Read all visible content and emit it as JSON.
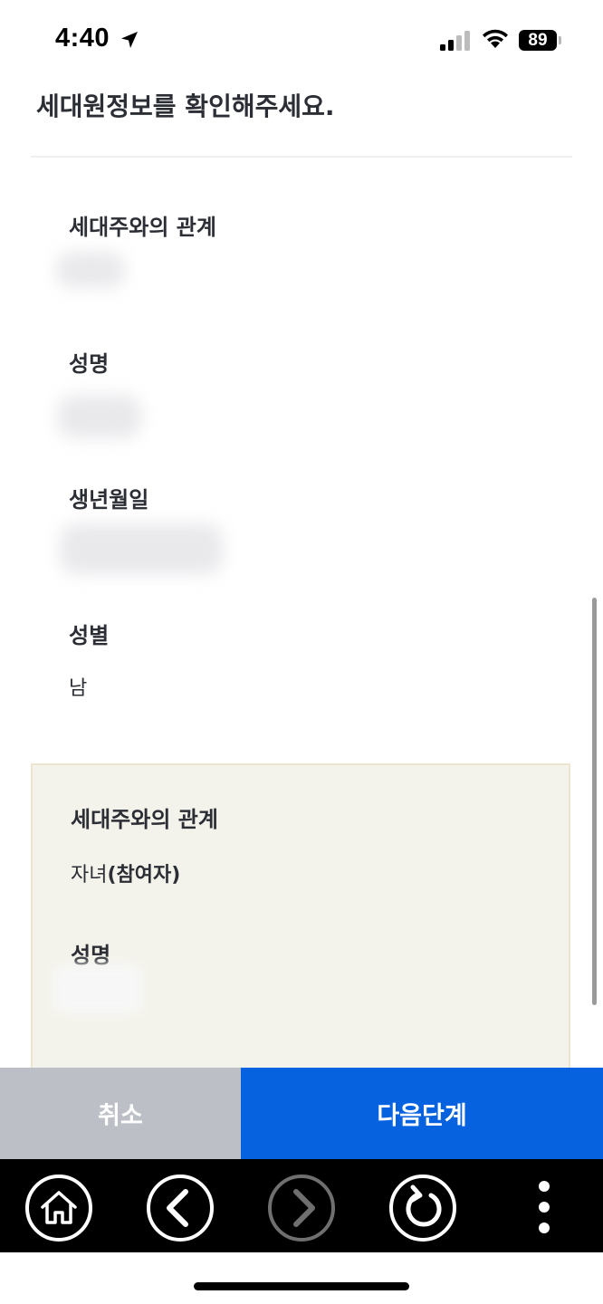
{
  "status_bar": {
    "time": "4:40",
    "battery": "89",
    "icons": [
      "location-arrow-icon",
      "cellular-signal-icon",
      "wifi-icon",
      "battery-icon"
    ]
  },
  "page": {
    "title": "세대원정보를 확인해주세요."
  },
  "fields": [
    {
      "label": "세대주와의 관계",
      "value": ""
    },
    {
      "label": "성명",
      "value": ""
    },
    {
      "label": "생년월일",
      "value": ""
    },
    {
      "label": "성별",
      "value": "남"
    }
  ],
  "card": {
    "relation_label": "세대주와의 관계",
    "relation_value_prefix": "자녀",
    "relation_value_suffix": "(참여자)",
    "name_label": "성명"
  },
  "actions": {
    "cancel": "취소",
    "next": "다음단계"
  },
  "toolbar": {
    "icons": [
      "home-icon",
      "back-icon",
      "forward-icon",
      "refresh-icon",
      "more-icon"
    ]
  },
  "colors": {
    "primary": "#0762e0",
    "cancel": "#bcc0c6",
    "card_bg": "#f4f3eb"
  }
}
